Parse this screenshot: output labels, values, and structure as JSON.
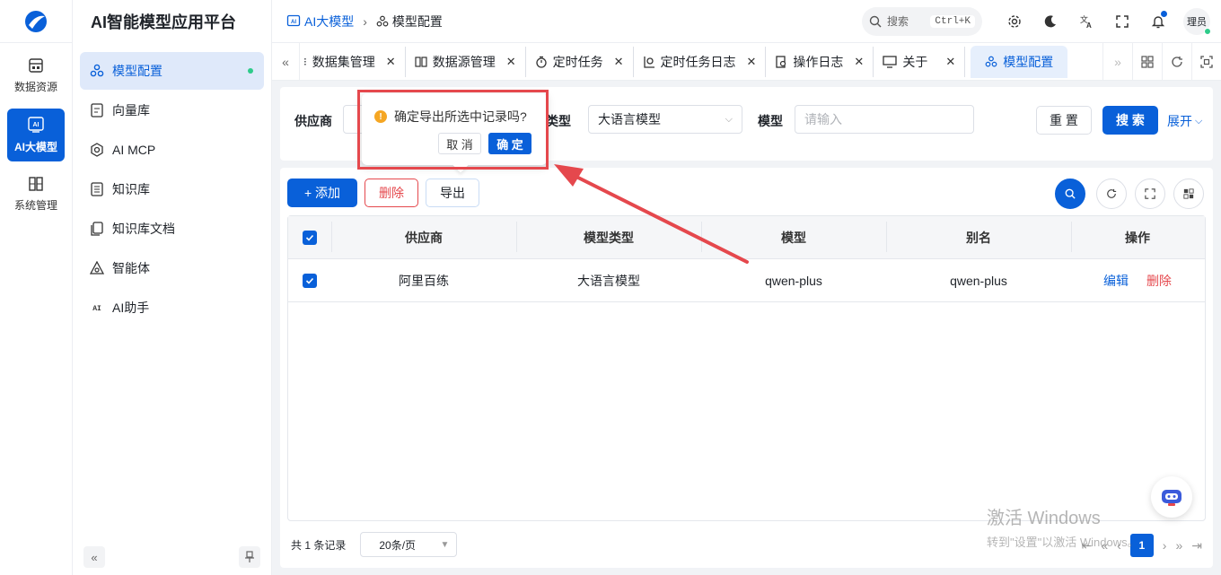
{
  "rail": {
    "items": [
      {
        "label": "数据资源",
        "icon": "database-icon"
      },
      {
        "label": "AI大模型",
        "icon": "ai-icon",
        "active": true
      },
      {
        "label": "系统管理",
        "icon": "settings-grid-icon"
      }
    ]
  },
  "sidebar": {
    "title": "AI智能模型应用平台",
    "items": [
      {
        "label": "模型配置",
        "icon": "model-config-icon",
        "active": true
      },
      {
        "label": "向量库",
        "icon": "vector-icon"
      },
      {
        "label": "AI MCP",
        "icon": "mcp-icon"
      },
      {
        "label": "知识库",
        "icon": "knowledge-icon"
      },
      {
        "label": "知识库文档",
        "icon": "document-icon"
      },
      {
        "label": "智能体",
        "icon": "agent-icon"
      },
      {
        "label": "AI助手",
        "icon": "assistant-icon"
      }
    ]
  },
  "header": {
    "breadcrumb": [
      "AI大模型",
      "模型配置"
    ],
    "search_label": "搜索",
    "shortcut": "Ctrl+K",
    "avatar_text": "理员"
  },
  "tabs": [
    {
      "label": "数据集管理"
    },
    {
      "label": "数据源管理"
    },
    {
      "label": "定时任务"
    },
    {
      "label": "定时任务日志"
    },
    {
      "label": "操作日志"
    },
    {
      "label": "关于"
    },
    {
      "label": "模型配置",
      "active": true
    }
  ],
  "filters": {
    "supplier_label": "供应商",
    "model_type_label": "模型类型",
    "model_type_value": "大语言模型",
    "model_label": "模型",
    "model_placeholder": "请输入",
    "reset": "重 置",
    "search": "搜 索",
    "expand": "展开"
  },
  "toolbar": {
    "add": "+ 添加",
    "delete": "删除",
    "export": "导出"
  },
  "table": {
    "columns": [
      "供应商",
      "模型类型",
      "模型",
      "别名",
      "操作"
    ],
    "rows": [
      {
        "supplier": "阿里百练",
        "model_type": "大语言模型",
        "model": "qwen-plus",
        "alias": "qwen-plus",
        "edit": "编辑",
        "delete": "删除",
        "checked": true
      }
    ]
  },
  "footer": {
    "total": "共 1 条记录",
    "page_size": "20条/页",
    "current_page": "1"
  },
  "popconfirm": {
    "message": "确定导出所选中记录吗?",
    "cancel": "取 消",
    "confirm": "确 定"
  },
  "watermark": {
    "line1": "激活 Windows",
    "line2": "转到\"设置\"以激活 Windows。"
  },
  "colors": {
    "primary": "#0960d9",
    "danger": "#e5484d",
    "online": "#2ecb8a",
    "highlight": "#e5484d"
  }
}
